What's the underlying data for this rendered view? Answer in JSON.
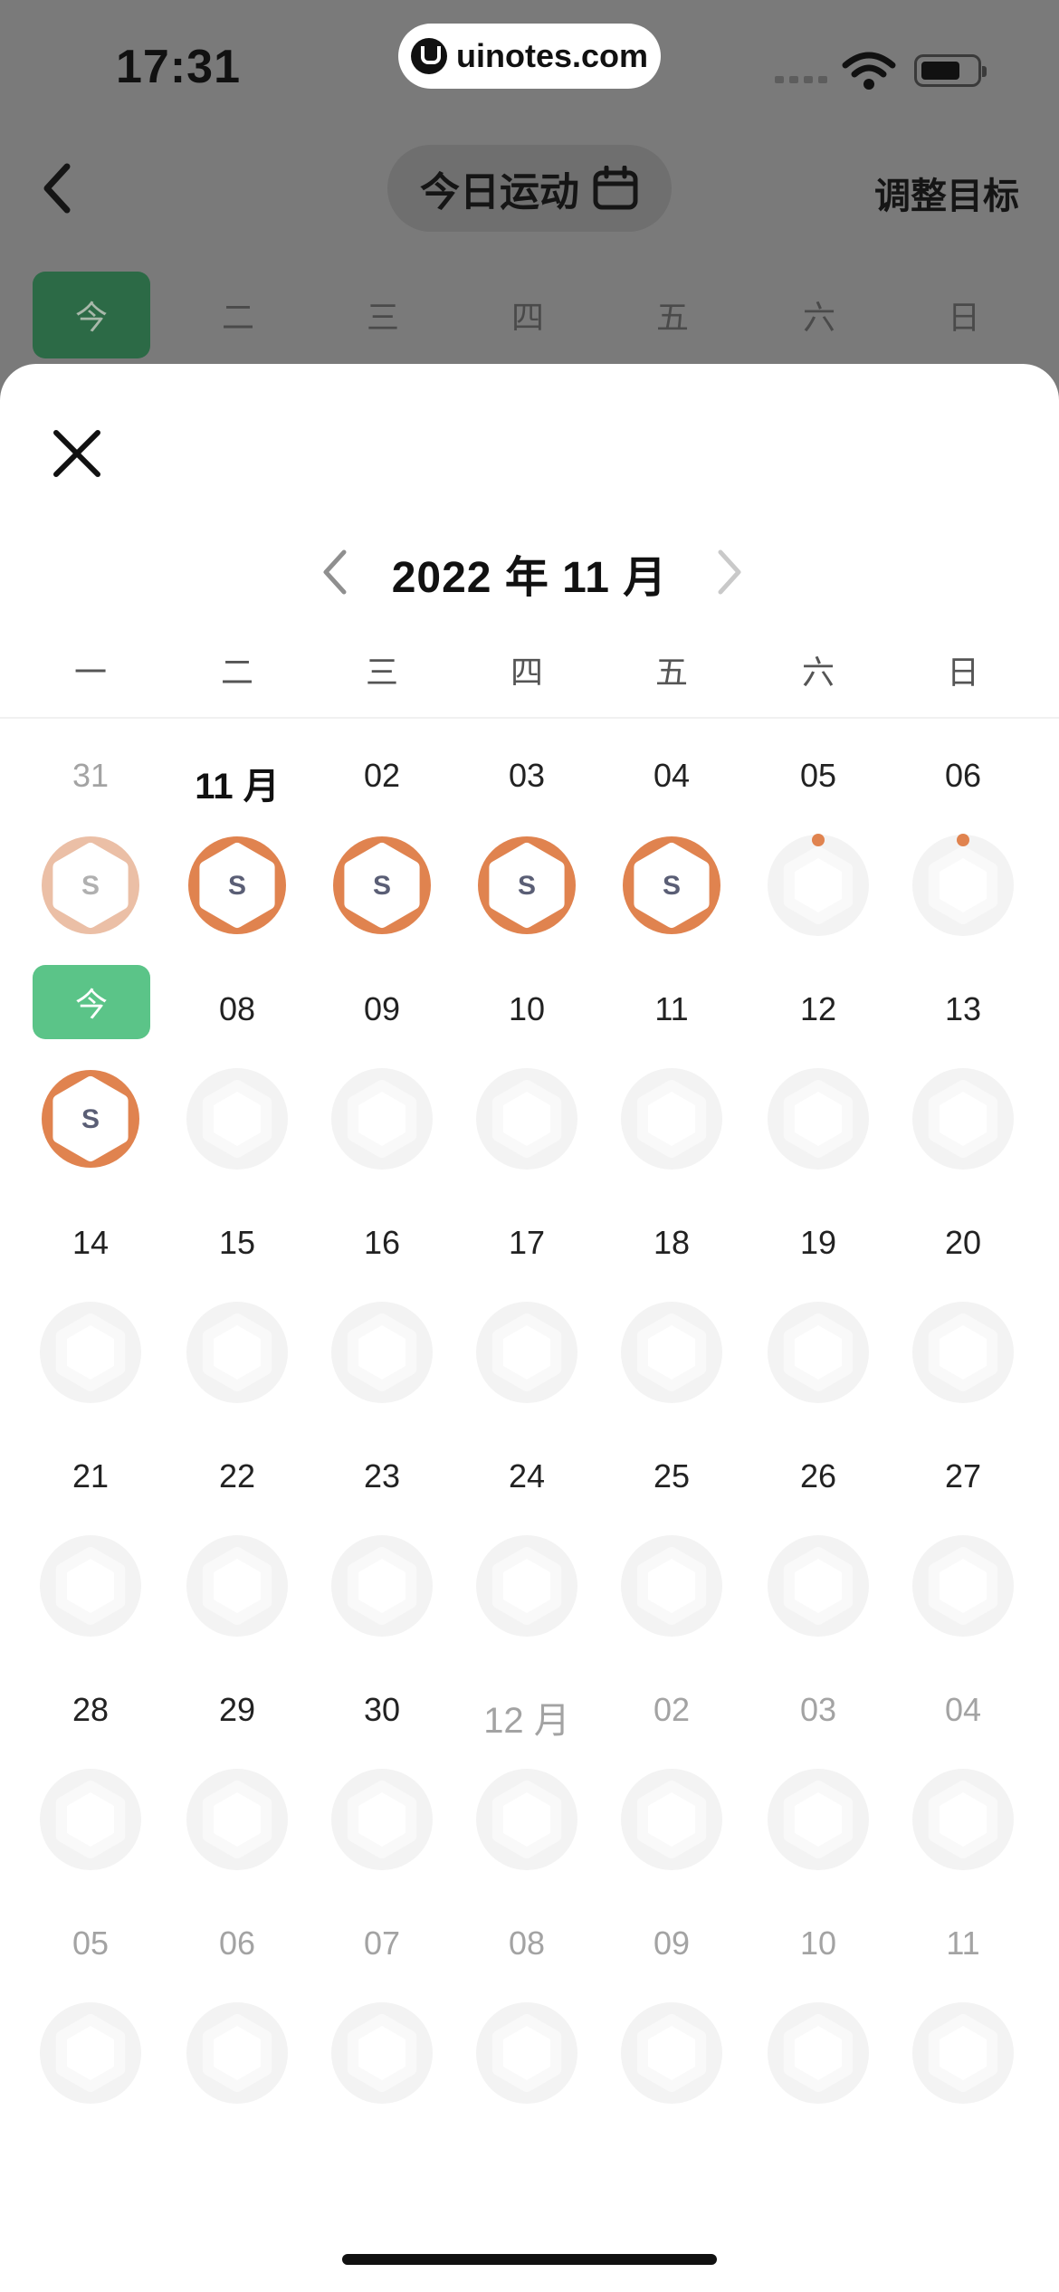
{
  "status_bar": {
    "time": "17:31",
    "watermark": "uinotes.com"
  },
  "header": {
    "title": "今日运动",
    "right_action": "调整目标",
    "calendar_icon": "calendar-icon"
  },
  "background_week": [
    {
      "label": "今",
      "today": true
    },
    {
      "label": "二"
    },
    {
      "label": "三"
    },
    {
      "label": "四"
    },
    {
      "label": "五"
    },
    {
      "label": "六"
    },
    {
      "label": "日"
    }
  ],
  "sheet": {
    "month_title": "2022 年 11 月",
    "weekdays": [
      "一",
      "二",
      "三",
      "四",
      "五",
      "六",
      "日"
    ],
    "colors": {
      "accent": "#e0834f",
      "accent_light": "#ebbfa6",
      "today_green": "#5bc488",
      "empty_ring": "#f3f3f3"
    },
    "weeks": [
      [
        {
          "label": "31",
          "muted": true,
          "ring": "partial",
          "mark": "S"
        },
        {
          "label": "11 月",
          "month_mark": true,
          "ring": "full",
          "mark": "S"
        },
        {
          "label": "02",
          "ring": "full",
          "mark": "S"
        },
        {
          "label": "03",
          "ring": "full",
          "mark": "S"
        },
        {
          "label": "04",
          "ring": "full",
          "mark": "S"
        },
        {
          "label": "05",
          "ring": "dot"
        },
        {
          "label": "06",
          "ring": "dot"
        }
      ],
      [
        {
          "label": "今",
          "today": true,
          "ring": "full",
          "mark": "S"
        },
        {
          "label": "08",
          "ring": "empty"
        },
        {
          "label": "09",
          "ring": "empty"
        },
        {
          "label": "10",
          "ring": "empty"
        },
        {
          "label": "11",
          "ring": "empty"
        },
        {
          "label": "12",
          "ring": "empty"
        },
        {
          "label": "13",
          "ring": "empty"
        }
      ],
      [
        {
          "label": "14",
          "ring": "empty"
        },
        {
          "label": "15",
          "ring": "empty"
        },
        {
          "label": "16",
          "ring": "empty"
        },
        {
          "label": "17",
          "ring": "empty"
        },
        {
          "label": "18",
          "ring": "empty"
        },
        {
          "label": "19",
          "ring": "empty"
        },
        {
          "label": "20",
          "ring": "empty"
        }
      ],
      [
        {
          "label": "21",
          "ring": "empty"
        },
        {
          "label": "22",
          "ring": "empty"
        },
        {
          "label": "23",
          "ring": "empty"
        },
        {
          "label": "24",
          "ring": "empty"
        },
        {
          "label": "25",
          "ring": "empty"
        },
        {
          "label": "26",
          "ring": "empty"
        },
        {
          "label": "27",
          "ring": "empty"
        }
      ],
      [
        {
          "label": "28",
          "ring": "empty"
        },
        {
          "label": "29",
          "ring": "empty"
        },
        {
          "label": "30",
          "ring": "empty"
        },
        {
          "label": "12 月",
          "month_mark": true,
          "muted": true,
          "ring": "empty"
        },
        {
          "label": "02",
          "muted": true,
          "ring": "empty"
        },
        {
          "label": "03",
          "muted": true,
          "ring": "empty"
        },
        {
          "label": "04",
          "muted": true,
          "ring": "empty"
        }
      ],
      [
        {
          "label": "05",
          "muted": true,
          "ring": "empty"
        },
        {
          "label": "06",
          "muted": true,
          "ring": "empty"
        },
        {
          "label": "07",
          "muted": true,
          "ring": "empty"
        },
        {
          "label": "08",
          "muted": true,
          "ring": "empty"
        },
        {
          "label": "09",
          "muted": true,
          "ring": "empty"
        },
        {
          "label": "10",
          "muted": true,
          "ring": "empty"
        },
        {
          "label": "11",
          "muted": true,
          "ring": "empty"
        }
      ]
    ]
  }
}
